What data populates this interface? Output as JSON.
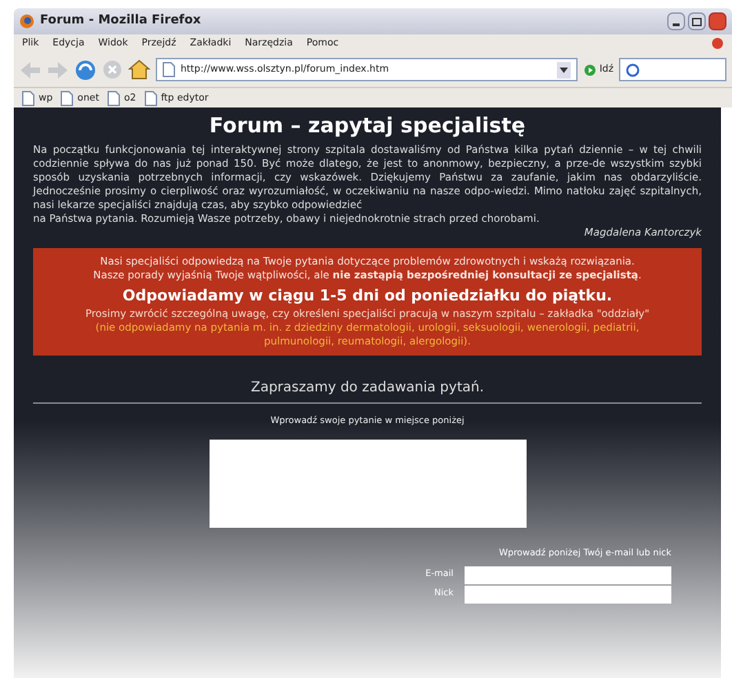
{
  "window": {
    "title": "Forum - Mozilla Firefox"
  },
  "menu": [
    "Plik",
    "Edycja",
    "Widok",
    "Przejdź",
    "Zakładki",
    "Narzędzia",
    "Pomoc"
  ],
  "address": {
    "value": "http://www.wss.olsztyn.pl/forum_index.htm"
  },
  "go_button": "Idź",
  "bookmarks": [
    "wp",
    "onet",
    "o2",
    "ftp edytor"
  ],
  "page": {
    "heading": "Forum – zapytaj specjalistę",
    "intro": [
      "Na początku funkcjonowania tej interaktywnej strony szpitala dostawaliśmy od Państwa kilka pytań dziennie – w tej chwili codziennie spływa do nas już ponad 150. Być może dlatego, że jest to anonmowy, bezpieczny, a prze-de wszystkim szybki sposób uzyskania potrzebnych informacji, czy wskazówek. Dziękujemy Państwu za zaufanie, jakim nas obdarzyliście. Jednocześnie prosimy o cierpliwość oraz wyrozumiałość, w oczekiwaniu na nasze odpo-wiedzi. Mimo natłoku zajęć szpitalnych, nasi lekarze specjaliści znajdują czas, aby szybko odpowiedzieć",
      "na Państwa pytania. Rozumieją Wasze potrzeby, obawy i niejednokrotnie strach przed chorobami."
    ],
    "signature": "Magdalena Kantorczyk",
    "notice": {
      "lines": [
        "Nasi specjaliści odpowiedzą na Twoje pytania dotyczące problemów zdrowotnych i wskażą rozwiązania.",
        "Nasze porady wyjaśnią Twoje wątpliwości, ale **nie zastąpią bezpośredniej konsultacji ze specjalistą**."
      ],
      "headline": "Odpowiadamy w ciągu 1-5 dni od poniedziałku do piątku.",
      "remark": "Prosimy zwrócić szczególną uwagę, czy określeni specjaliści pracują w naszym szpitalu – zakładka \"oddziały\"",
      "exclusions": "(nie odpowiadamy na pytania m. in. z dziedziny dermatologii, urologii, seksuologii, wenerologii, pediatrii, pulmunologii, reumatologii, alergologii)."
    },
    "invite": "Zapraszamy do zadawania pytań.",
    "question_prompt": "Wprowadź swoje pytanie w miejsce poniżej",
    "contact_prompt": "Wprowadź poniżej Twój e-mail lub nick",
    "fields": [
      {
        "label": "E-mail"
      },
      {
        "label": "Nick"
      }
    ]
  }
}
